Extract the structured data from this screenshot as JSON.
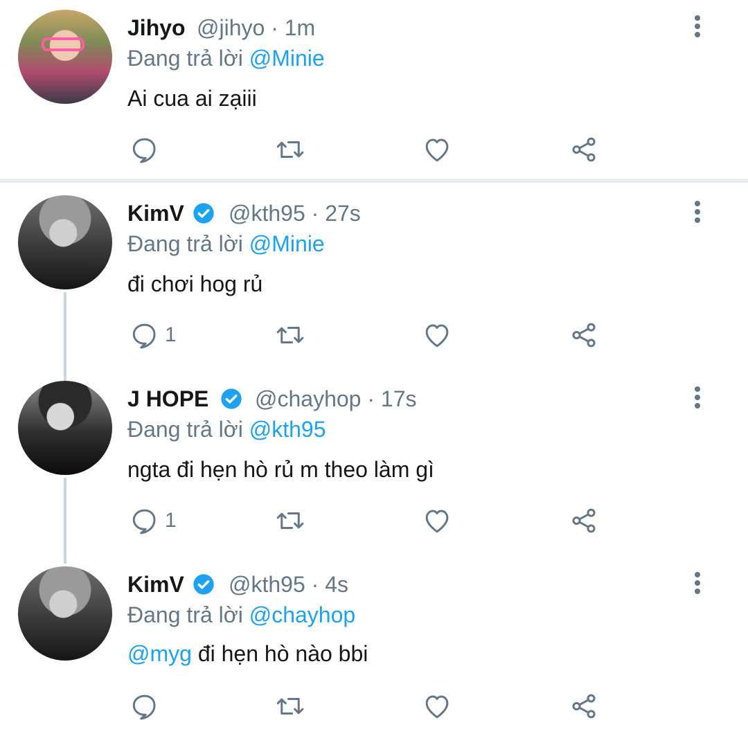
{
  "colors": {
    "accent": "#1da1f2",
    "secondary_text": "#657786",
    "primary_text": "#14171a",
    "divider": "#e6ecf0"
  },
  "tweets": [
    {
      "name": "Jihyo",
      "handle": "@jihyo",
      "time": "· 1m",
      "verified": false,
      "reply_prefix": "Đang trả lời",
      "reply_to": "@Minie",
      "text_mention": "",
      "text": "Ai cua ai zạiii",
      "reply_count": ""
    },
    {
      "name": "KimV",
      "handle": "@kth95",
      "time": "· 27s",
      "verified": true,
      "reply_prefix": "Đang trả lời",
      "reply_to": "@Minie",
      "text_mention": "",
      "text": "đi chơi hog rủ",
      "reply_count": "1"
    },
    {
      "name": "J HOPE",
      "handle": "@chayhop",
      "time": "· 17s",
      "verified": true,
      "reply_prefix": "Đang trả lời",
      "reply_to": "@kth95",
      "text_mention": "",
      "text": "ngta đi hẹn hò rủ m theo làm gì",
      "reply_count": "1"
    },
    {
      "name": "KimV",
      "handle": "@kth95",
      "time": "· 4s",
      "verified": true,
      "reply_prefix": "Đang trả lời",
      "reply_to": "@chayhop",
      "text_mention": "@myg",
      "text": "đi hẹn hò nào bbi",
      "reply_count": ""
    }
  ],
  "icons": {
    "reply": "reply-icon",
    "retweet": "retweet-icon",
    "like": "heart-icon",
    "share": "share-icon",
    "more": "more-vertical-icon",
    "verified": "verified-badge-icon"
  }
}
